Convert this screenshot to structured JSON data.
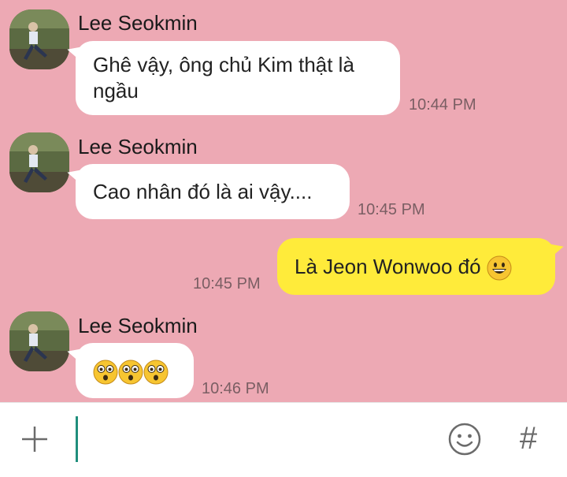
{
  "messages": [
    {
      "sender": "Lee Seokmin",
      "text": "Ghê vậy, ông chủ Kim thật là ngầu",
      "time": "10:44 PM"
    },
    {
      "sender": "Lee Seokmin",
      "text": "Cao nhân đó là ai vậy....",
      "time": "10:45 PM"
    },
    {
      "sender": "me",
      "text": "Là Jeon Wonwoo đó",
      "emoji": "grinning-face-icon",
      "time": "10:45 PM"
    },
    {
      "sender": "Lee Seokmin",
      "emoji_count": 3,
      "emoji": "astonished-face-icon",
      "time": "10:46 PM"
    }
  ],
  "colors": {
    "background": "#EDA9B4",
    "incoming_bubble": "#FFFFFF",
    "outgoing_bubble": "#FFEB3A",
    "cursor": "#1F8E7C"
  },
  "input": {
    "value": "",
    "icons": [
      "plus-icon",
      "smiley-icon",
      "hash-icon"
    ],
    "hash_glyph": "#"
  }
}
